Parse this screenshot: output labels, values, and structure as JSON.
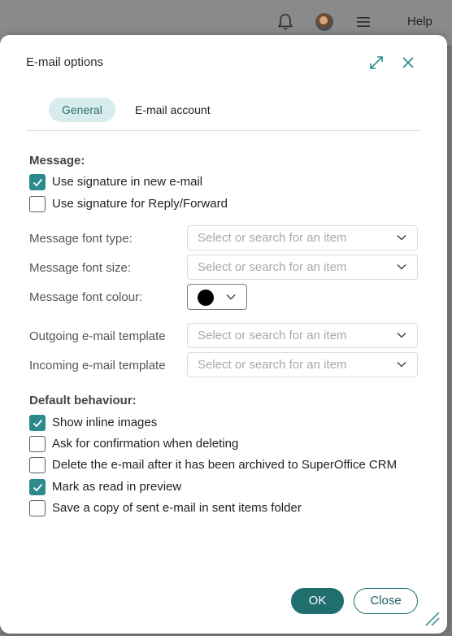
{
  "topbar": {
    "help_label": "Help",
    "icons": [
      "bell-icon",
      "avatar",
      "hamburger-menu-icon"
    ]
  },
  "dialog": {
    "title": "E-mail options",
    "icons": {
      "expand": "expand-icon",
      "close": "close-icon"
    },
    "tabs": [
      {
        "label": "General",
        "active": true
      },
      {
        "label": "E-mail account",
        "active": false
      }
    ],
    "message_section": {
      "title": "Message:",
      "checkboxes": [
        {
          "label": "Use signature in new e-mail",
          "checked": true
        },
        {
          "label": "Use signature for Reply/Forward",
          "checked": false
        }
      ]
    },
    "fields": {
      "font_type": {
        "label": "Message font type:",
        "placeholder": "Select or search for an item"
      },
      "font_size": {
        "label": "Message font size:",
        "placeholder": "Select or search for an item"
      },
      "font_colour": {
        "label": "Message font colour:",
        "value": "#000000"
      },
      "outgoing_template": {
        "label": "Outgoing e-mail template",
        "placeholder": "Select or search for an item"
      },
      "incoming_template": {
        "label": "Incoming e-mail template",
        "placeholder": "Select or search for an item"
      }
    },
    "default_section": {
      "title": "Default behaviour:",
      "checkboxes": [
        {
          "label": "Show inline images",
          "checked": true
        },
        {
          "label": "Ask for confirmation when deleting",
          "checked": false
        },
        {
          "label": "Delete the e-mail after it has been archived to SuperOffice CRM",
          "checked": false
        },
        {
          "label": "Mark as read in preview",
          "checked": true
        },
        {
          "label": "Save a copy of sent e-mail in sent items folder",
          "checked": false
        }
      ]
    },
    "buttons": {
      "ok": "OK",
      "close": "Close"
    }
  },
  "colors": {
    "accent": "#2a8a8c",
    "primary_button": "#1f6f6f",
    "tab_active_bg": "#d7ecec",
    "overlay": "#7a7a7a"
  }
}
